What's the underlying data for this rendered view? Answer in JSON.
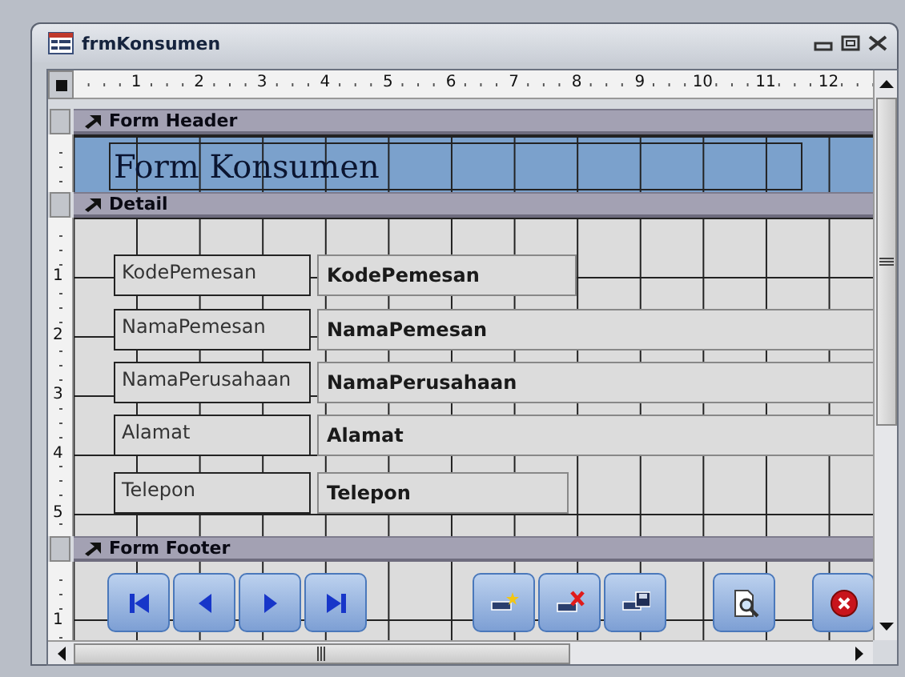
{
  "window": {
    "title": "frmKonsumen"
  },
  "ruler": {
    "marks": [
      "1",
      "2",
      "3",
      "4",
      "5",
      "6",
      "7",
      "8",
      "9",
      "10",
      "11",
      "12"
    ]
  },
  "sections": [
    {
      "kind": "header",
      "title": "Form Header",
      "title_label": "Form Konsumen"
    },
    {
      "kind": "detail",
      "title": "Detail",
      "ruler_marks": [
        "1",
        "2",
        "3",
        "4",
        "5"
      ],
      "fields": [
        {
          "label": "KodePemesan",
          "textbox": "KodePemesan"
        },
        {
          "label": "NamaPemesan",
          "textbox": "NamaPemesan"
        },
        {
          "label": "NamaPerusahaan",
          "textbox": "NamaPerusahaan"
        },
        {
          "label": "Alamat",
          "textbox": "Alamat"
        },
        {
          "label": "Telepon",
          "textbox": "Telepon"
        }
      ]
    },
    {
      "kind": "footer",
      "title": "Form Footer",
      "ruler_marks": [
        "1"
      ],
      "buttons": [
        {
          "kind": "first"
        },
        {
          "kind": "prev"
        },
        {
          "kind": "next"
        },
        {
          "kind": "last"
        },
        {
          "kind": "new"
        },
        {
          "kind": "delete"
        },
        {
          "kind": "save"
        },
        {
          "kind": "preview"
        },
        {
          "kind": "close"
        }
      ]
    }
  ]
}
